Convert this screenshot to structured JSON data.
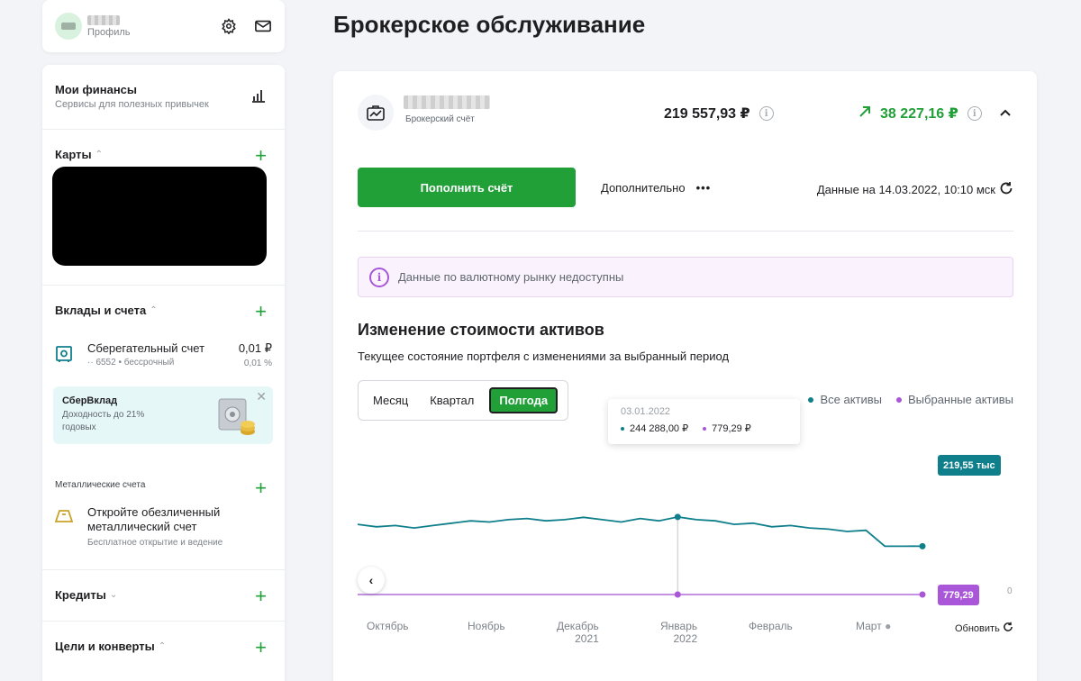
{
  "profile": {
    "label": "Профиль"
  },
  "sidebar": {
    "finances": {
      "title": "Мои финансы",
      "subtitle": "Сервисы для полезных привычек"
    },
    "cards": {
      "title": "Карты"
    },
    "deposits": {
      "title": "Вклады и счета",
      "account": {
        "name": "Сберегательный счет",
        "meta": "·· 6552 • бессрочный",
        "amount": "0,01 ₽",
        "percent": "0,01 %"
      },
      "promo": {
        "title": "СберВклад",
        "text": "Доходность до 21% годовых"
      }
    },
    "metals": {
      "label": "Металлические счета",
      "name": "Откройте обезличенный металлический счет",
      "meta": "Бесплатное открытие и ведение"
    },
    "credits": {
      "title": "Кредиты"
    },
    "goals": {
      "title": "Цели и конверты"
    }
  },
  "main": {
    "title": "Брокерское обслуживание",
    "account_label": "Брокерский счёт",
    "balance": "219 557,93 ₽",
    "profit": "38 227,16 ₽",
    "topup_label": "Пополнить счёт",
    "more_label": "Дополнительно",
    "updated": "Данные на 14.03.2022, 10:10 мск",
    "alert": "Данные по валютному рынку недоступны",
    "chart_title": "Изменение стоимости активов",
    "chart_subtitle": "Текущее состояние портфеля с изменениями за выбранный период",
    "tabs": [
      "Месяц",
      "Квартал",
      "Полгода"
    ],
    "refresh_label": "Обновить"
  },
  "colors": {
    "accent": "#21a038",
    "all_assets": "#107f8c",
    "selected_assets": "#a957d8"
  },
  "chart_data": {
    "type": "line",
    "legend": [
      "Все активы",
      "Выбранные активы"
    ],
    "months": [
      {
        "name": "Октябрь",
        "year": ""
      },
      {
        "name": "Ноябрь",
        "year": ""
      },
      {
        "name": "Декабрь",
        "year": "2021"
      },
      {
        "name": "Январь",
        "year": "2022"
      },
      {
        "name": "Февраль",
        "year": ""
      },
      {
        "name": "Март",
        "year": ""
      }
    ],
    "series": [
      {
        "name": "Все активы",
        "values_thousands": [
          238,
          236,
          237,
          235,
          237,
          239,
          241,
          240,
          242,
          243,
          241,
          242,
          244,
          242,
          240,
          243,
          241,
          244.3,
          242,
          241,
          238,
          239,
          236,
          237,
          235,
          234,
          232,
          233,
          219.6,
          219.5,
          219.55
        ],
        "last_label": "219,55 тыс"
      },
      {
        "name": "Выбранные активы",
        "last_label": "779,29"
      }
    ],
    "y_zero_label": "0",
    "tooltip": {
      "date": "03.01.2022",
      "all_value": "244 288,00 ₽",
      "selected_value": "779,29 ₽"
    }
  }
}
